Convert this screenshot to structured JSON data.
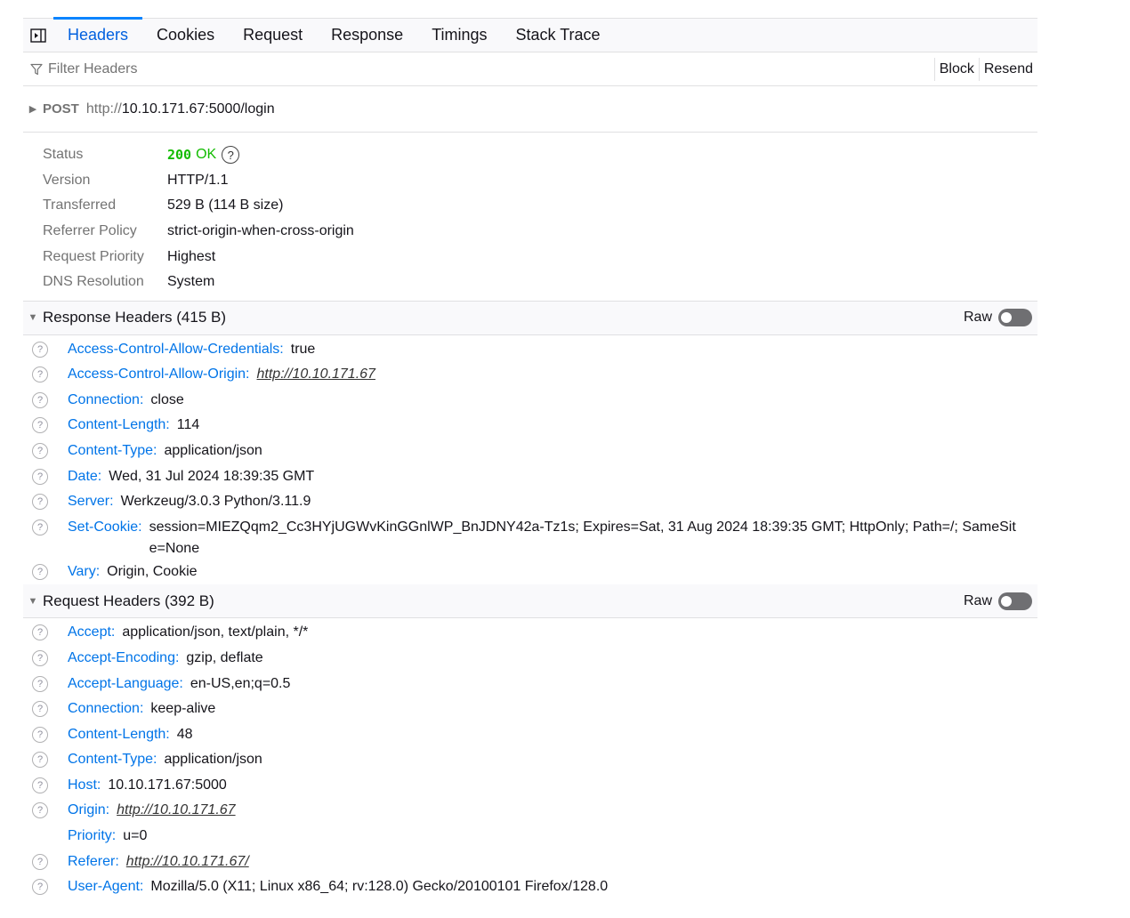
{
  "tabs": [
    "Headers",
    "Cookies",
    "Request",
    "Response",
    "Timings",
    "Stack Trace"
  ],
  "filter": {
    "placeholder": "Filter Headers",
    "block_label": "Block",
    "resend_label": "Resend"
  },
  "request": {
    "method": "POST",
    "url_scheme": "http://",
    "url_rest": "10.10.171.67:5000/login"
  },
  "status": {
    "label": "Status",
    "code": "200",
    "text": "OK",
    "help": "?",
    "rows": [
      {
        "label": "Version",
        "value": "HTTP/1.1"
      },
      {
        "label": "Transferred",
        "value": "529 B (114 B size)"
      },
      {
        "label": "Referrer Policy",
        "value": "strict-origin-when-cross-origin"
      },
      {
        "label": "Request Priority",
        "value": "Highest"
      },
      {
        "label": "DNS Resolution",
        "value": "System"
      }
    ]
  },
  "response_headers": {
    "title": "Response Headers (415 B)",
    "raw_label": "Raw",
    "items": [
      {
        "name": "Access-Control-Allow-Credentials:",
        "value": "true"
      },
      {
        "name": "Access-Control-Allow-Origin:",
        "value": "http://10.10.171.67"
      },
      {
        "name": "Connection:",
        "value": "close"
      },
      {
        "name": "Content-Length:",
        "value": "114"
      },
      {
        "name": "Content-Type:",
        "value": "application/json"
      },
      {
        "name": "Date:",
        "value": "Wed, 31 Jul 2024 18:39:35 GMT"
      },
      {
        "name": "Server:",
        "value": "Werkzeug/3.0.3 Python/3.11.9"
      },
      {
        "name": "Set-Cookie:",
        "value": "session=MIEZQqm2_Cc3HYjUGWvKinGGnlWP_BnJDNY42a-Tz1s; Expires=Sat, 31 Aug 2024 18:39:35 GMT; HttpOnly; Path=/; SameSite=None"
      },
      {
        "name": "Vary:",
        "value": "Origin, Cookie"
      }
    ]
  },
  "request_headers": {
    "title": "Request Headers (392 B)",
    "raw_label": "Raw",
    "items": [
      {
        "name": "Accept:",
        "value": "application/json, text/plain, */*"
      },
      {
        "name": "Accept-Encoding:",
        "value": "gzip, deflate"
      },
      {
        "name": "Accept-Language:",
        "value": "en-US,en;q=0.5"
      },
      {
        "name": "Connection:",
        "value": "keep-alive"
      },
      {
        "name": "Content-Length:",
        "value": "48"
      },
      {
        "name": "Content-Type:",
        "value": "application/json"
      },
      {
        "name": "Host:",
        "value": "10.10.171.67:5000"
      },
      {
        "name": "Origin:",
        "value": "http://10.10.171.67"
      },
      {
        "name": "Priority:",
        "value": "u=0"
      },
      {
        "name": "Referer:",
        "value": "http://10.10.171.67/"
      },
      {
        "name": "User-Agent:",
        "value": "Mozilla/5.0 (X11; Linux x86_64; rv:128.0) Gecko/20100101 Firefox/128.0"
      }
    ]
  },
  "help_glyph": "?"
}
